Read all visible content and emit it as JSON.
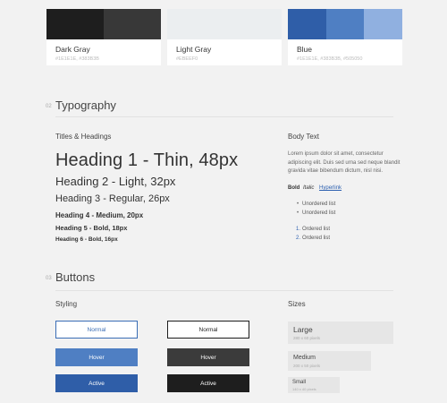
{
  "swatches": [
    {
      "name": "Dark Gray",
      "codes": "#1E1E1E, #383B3B",
      "colors": [
        "#1e1e1e",
        "#383838"
      ]
    },
    {
      "name": "Light Gray",
      "codes": "#EBEEF0",
      "colors": [
        "#ebeef0"
      ]
    },
    {
      "name": "Blue",
      "codes": "#1E1E1E, #383B3B, #505050",
      "colors": [
        "#2f5ea8",
        "#4f7fc3",
        "#90b0e0"
      ]
    }
  ],
  "typography": {
    "num": "02",
    "title": "Typography",
    "titles_heading": "Titles & Headings",
    "body_heading": "Body Text",
    "h1": "Heading 1 - Thin, 48px",
    "h2": "Heading 2 - Light, 32px",
    "h3": "Heading 3 - Regular, 26px",
    "h4": "Heading 4 - Medium, 20px",
    "h5": "Heading 5 - Bold, 18px",
    "h6": "Heading 6 - Bold, 16px",
    "body_text": "Lorem ipsum dolor sit amet, consectetur adipiscing elit. Duis sed urna sed neque blandit gravida vitae bibendum dictum, nisl nisi.",
    "bold": "Bold",
    "italic": "Italic",
    "hyperlink": "Hyperlink",
    "unordered": [
      "Unordered list",
      "Unordered list"
    ],
    "ordered": [
      {
        "num": "1.",
        "text": "Ordered list"
      },
      {
        "num": "2.",
        "text": "Ordered list"
      }
    ]
  },
  "buttons": {
    "num": "03",
    "title": "Buttons",
    "styling_heading": "Styling",
    "sizes_heading": "Sizes",
    "normal": "Normal",
    "hover": "Hover",
    "active": "Active",
    "sizes": [
      {
        "label": "Large",
        "dim": "280 x 60 pixels"
      },
      {
        "label": "Medium",
        "dim": "200 x 50 pixels"
      },
      {
        "label": "Small",
        "dim": "140 x 40 pixels"
      }
    ]
  }
}
